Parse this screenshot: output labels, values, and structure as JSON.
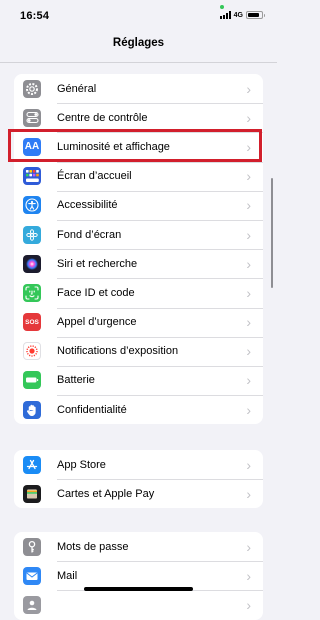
{
  "status_bar": {
    "time": "16:54",
    "network": "4G"
  },
  "nav": {
    "title": "Réglages"
  },
  "groups": [
    {
      "items": [
        {
          "label": "Général",
          "icon": "gear-icon",
          "color": "#8e8e93"
        },
        {
          "label": "Centre de contrôle",
          "icon": "control-center-icon",
          "color": "#8e8e93"
        },
        {
          "label": "Luminosité et affichage",
          "icon": "display-brightness-icon",
          "icon_text": "AA",
          "color": "#2f7cf6",
          "highlighted": true
        },
        {
          "label": "Écran d’accueil",
          "icon": "home-screen-icon",
          "color": "#2f5bd8"
        },
        {
          "label": "Accessibilité",
          "icon": "accessibility-icon",
          "color": "#1f84f0"
        },
        {
          "label": "Fond d’écran",
          "icon": "wallpaper-icon",
          "color": "#34aadc"
        },
        {
          "label": "Siri et recherche",
          "icon": "siri-icon",
          "color": "#1c1c2e"
        },
        {
          "label": "Face ID et code",
          "icon": "face-id-icon",
          "color": "#34c759"
        },
        {
          "label": "Appel d’urgence",
          "icon": "sos-icon",
          "icon_text": "SOS",
          "color": "#e5383b"
        },
        {
          "label": "Notifications d’exposition",
          "icon": "exposure-notification-icon",
          "color": "#ffffff"
        },
        {
          "label": "Batterie",
          "icon": "battery-icon",
          "color": "#34c759"
        },
        {
          "label": "Confidentialité",
          "icon": "privacy-hand-icon",
          "color": "#2f6bd8"
        }
      ]
    },
    {
      "items": [
        {
          "label": "App Store",
          "icon": "app-store-icon",
          "color": "#1a8cf5"
        },
        {
          "label": "Cartes et Apple Pay",
          "icon": "wallet-icon",
          "color": "#1c1c1e"
        }
      ]
    },
    {
      "items": [
        {
          "label": "Mots de passe",
          "icon": "key-icon",
          "color": "#8e8e93"
        },
        {
          "label": "Mail",
          "icon": "mail-icon",
          "color": "#2f88f5"
        },
        {
          "label": "",
          "icon": "contacts-icon",
          "color": "#9a9aa0"
        }
      ]
    }
  ]
}
